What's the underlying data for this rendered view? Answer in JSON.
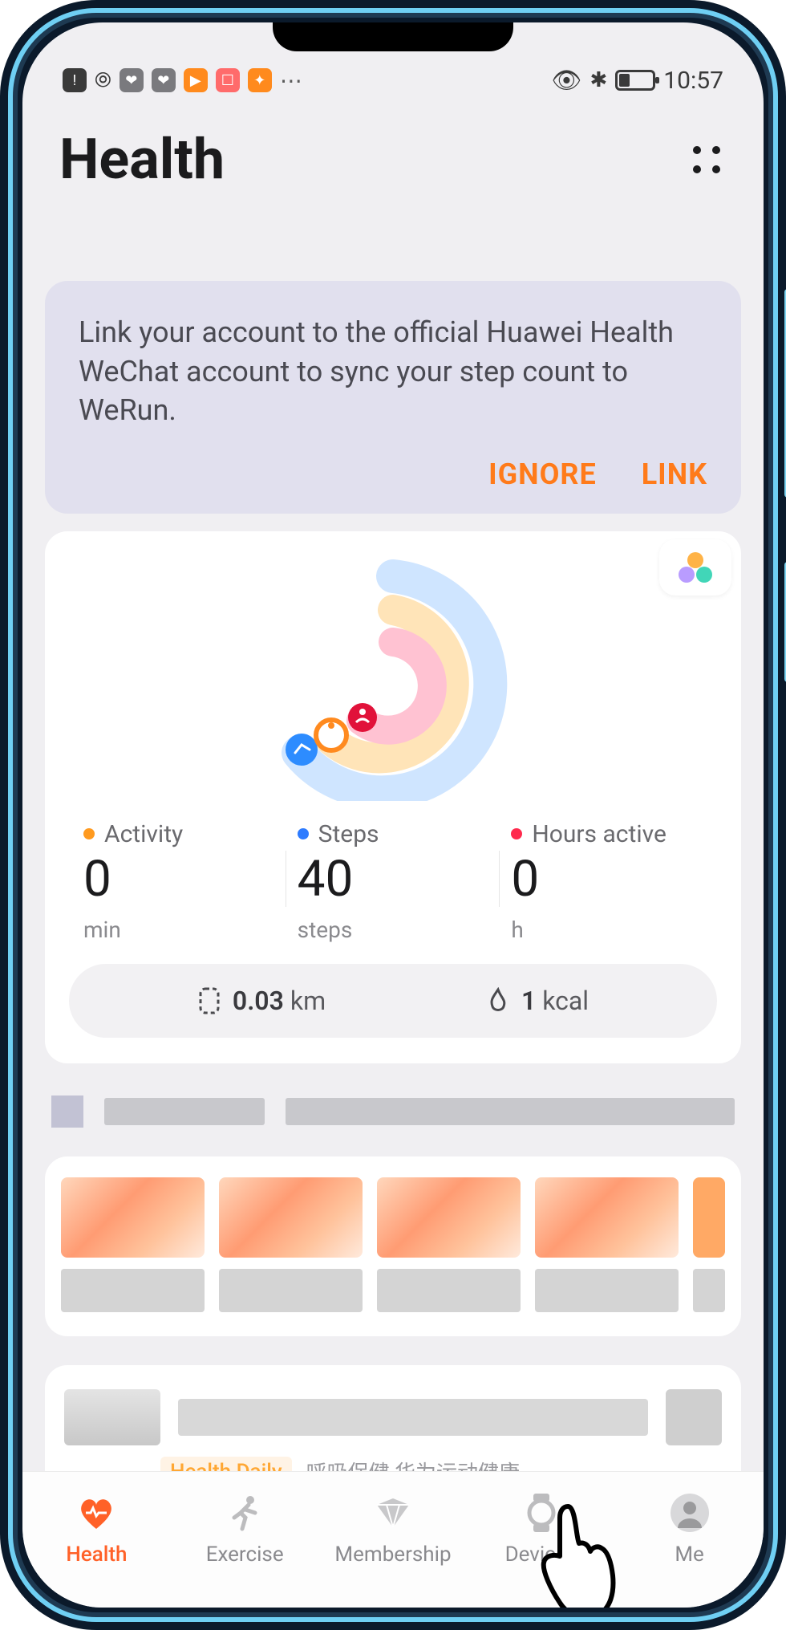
{
  "statusbar": {
    "time": "10:57"
  },
  "header": {
    "title": "Health"
  },
  "banner": {
    "text": "Link your account to the official Huawei Health WeChat account to sync your step count to WeRun.",
    "ignore": "IGNORE",
    "link": "LINK"
  },
  "rings": {
    "colors": {
      "outer": "#cfe5ff",
      "middle": "#ffe4b8",
      "inner": "#ffc2d2"
    },
    "icons": {
      "shoe": "#2d8cff",
      "clock": "#ff8a1f",
      "person": "#e1123a"
    }
  },
  "stats": {
    "activity": {
      "label": "Activity",
      "value": "0",
      "unit": "min"
    },
    "steps": {
      "label": "Steps",
      "value": "40",
      "unit": "steps"
    },
    "hours": {
      "label": "Hours active",
      "value": "0",
      "unit": "h"
    }
  },
  "pill": {
    "distance": {
      "value": "0.03",
      "unit": "km"
    },
    "kcal": {
      "value": "1",
      "unit": "kcal"
    }
  },
  "tags": {
    "daily": "Health Daily",
    "grey": "呼吸保健 华为运动健康"
  },
  "nav": {
    "health": "Health",
    "exercise": "Exercise",
    "membership": "Membership",
    "devices": "Devices",
    "me": "Me"
  }
}
